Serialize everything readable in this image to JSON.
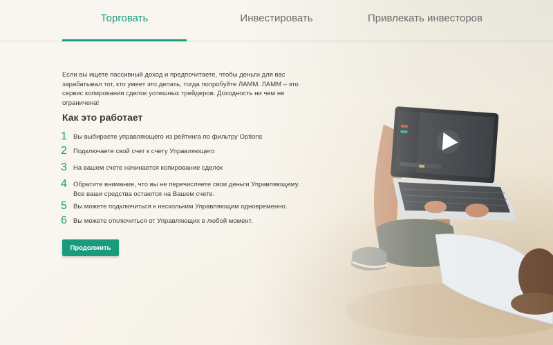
{
  "tabs": [
    {
      "label": "Торговать",
      "active": true
    },
    {
      "label": "Инвестировать",
      "active": false
    },
    {
      "label": "Привлекать инвесторов",
      "active": false
    }
  ],
  "intro": "Если вы ищете пассивный доход и предпочитаете, чтобы деньги для вас зарабатывал тот, кто умеет это делать, тогда попробуйте ЛАММ. ЛАММ – это сервис копирования сделок успешных трейдеров. Доходность ни чем не ограничена!",
  "how_title": "Как это работает",
  "steps": [
    {
      "num": "1",
      "text": "Вы выбираете управляющего из рейтинга по фильтру Options"
    },
    {
      "num": "2",
      "text": "Подключаете свой счет к счету Управляющего"
    },
    {
      "num": "3",
      "text": "На вашем счете начинается копирование сделок"
    },
    {
      "num": "4",
      "text": "Обратите внимание, что вы не перечисляете свои деньги Управляющему. Все ваши средства остаются на Вашем счете."
    },
    {
      "num": "5",
      "text": "Вы можете подключиться к нескольким Управляющим одновременно."
    },
    {
      "num": "6",
      "text": "Вы можете отключиться от Управляющих в любой момент."
    }
  ],
  "cta_label": "Продолжить",
  "colors": {
    "accent": "#1a9b7c"
  },
  "illustration": {
    "play_icon": "play-icon"
  }
}
